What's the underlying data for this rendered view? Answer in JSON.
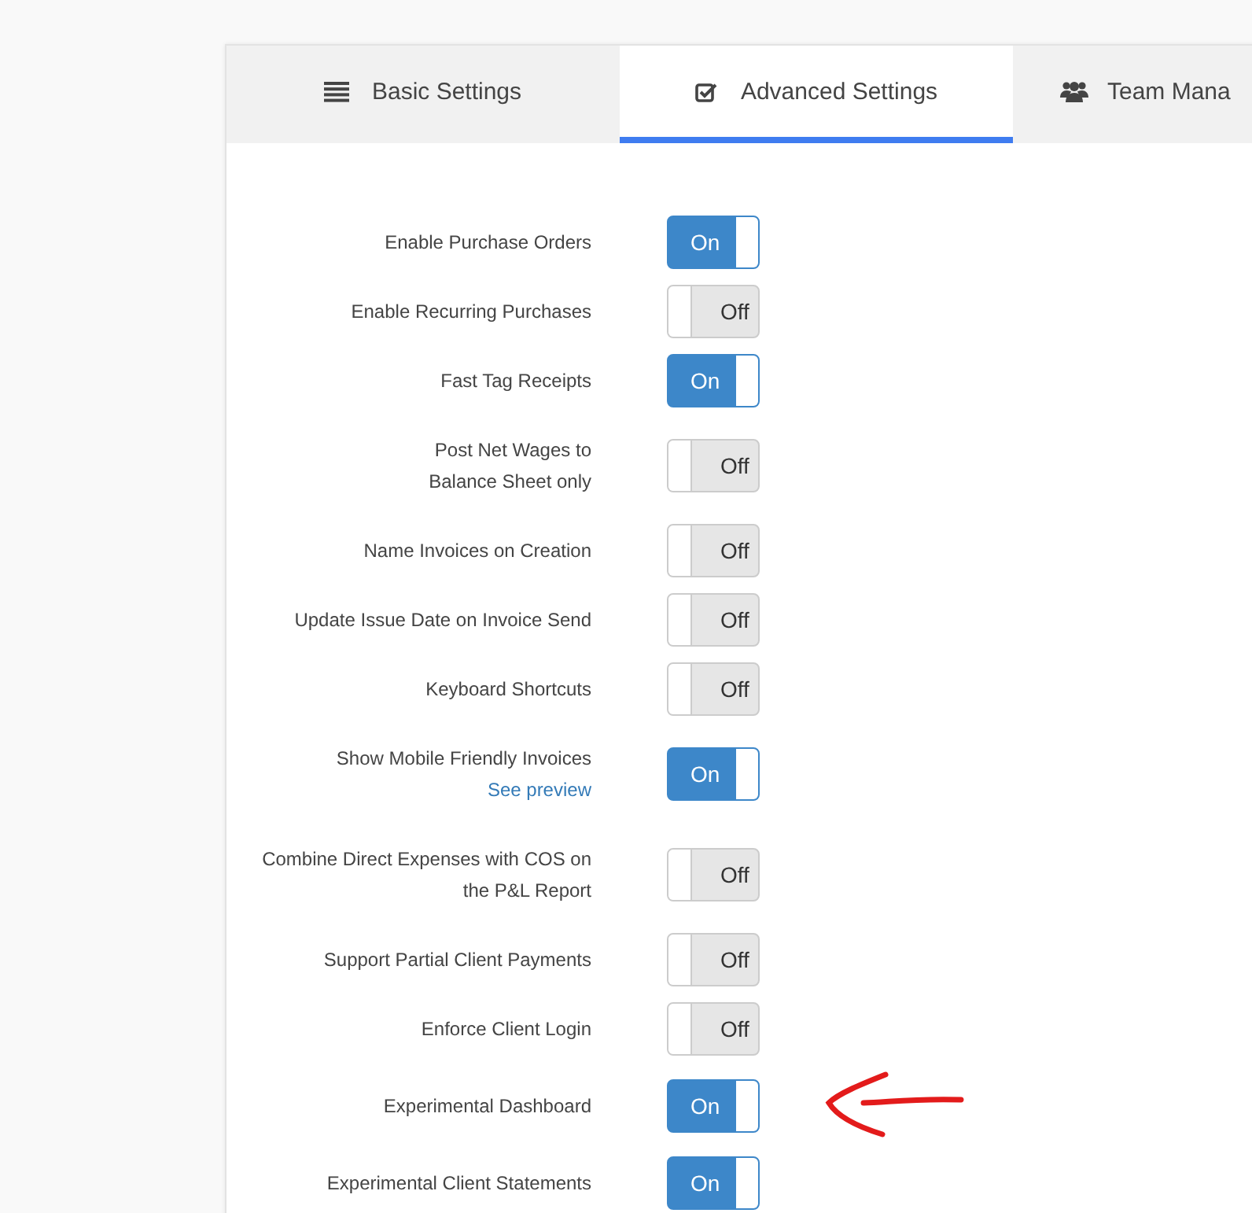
{
  "tabs": [
    {
      "label": "Basic Settings",
      "selected": false
    },
    {
      "label": "Advanced Settings",
      "selected": true
    },
    {
      "label": "Team Mana",
      "selected": false
    }
  ],
  "settings": [
    {
      "label": [
        "Enable Purchase Orders"
      ],
      "on": true,
      "toggle_text": "On"
    },
    {
      "label": [
        "Enable Recurring Purchases"
      ],
      "on": false,
      "toggle_text": "Off"
    },
    {
      "label": [
        "Fast Tag Receipts"
      ],
      "on": true,
      "toggle_text": "On"
    },
    {
      "label": [
        "Post Net Wages to",
        "Balance Sheet only"
      ],
      "on": false,
      "toggle_text": "Off"
    },
    {
      "label": [
        "Name Invoices on Creation"
      ],
      "on": false,
      "toggle_text": "Off"
    },
    {
      "label": [
        "Update Issue Date on Invoice Send"
      ],
      "on": false,
      "toggle_text": "Off"
    },
    {
      "label": [
        "Keyboard Shortcuts"
      ],
      "on": false,
      "toggle_text": "Off"
    },
    {
      "label": [
        "Show Mobile Friendly Invoices"
      ],
      "link": "See preview",
      "on": true,
      "toggle_text": "On"
    },
    {
      "label": [
        "Combine Direct Expenses with COS on",
        "the P&L Report"
      ],
      "on": false,
      "toggle_text": "Off"
    },
    {
      "label": [
        "Support Partial Client Payments"
      ],
      "on": false,
      "toggle_text": "Off"
    },
    {
      "label": [
        "Enforce Client Login"
      ],
      "on": false,
      "toggle_text": "Off"
    },
    {
      "label": [
        "Experimental Dashboard"
      ],
      "on": true,
      "toggle_text": "On",
      "annotated": true
    },
    {
      "label": [
        "Experimental Client Statements"
      ],
      "on": true,
      "toggle_text": "On"
    }
  ]
}
